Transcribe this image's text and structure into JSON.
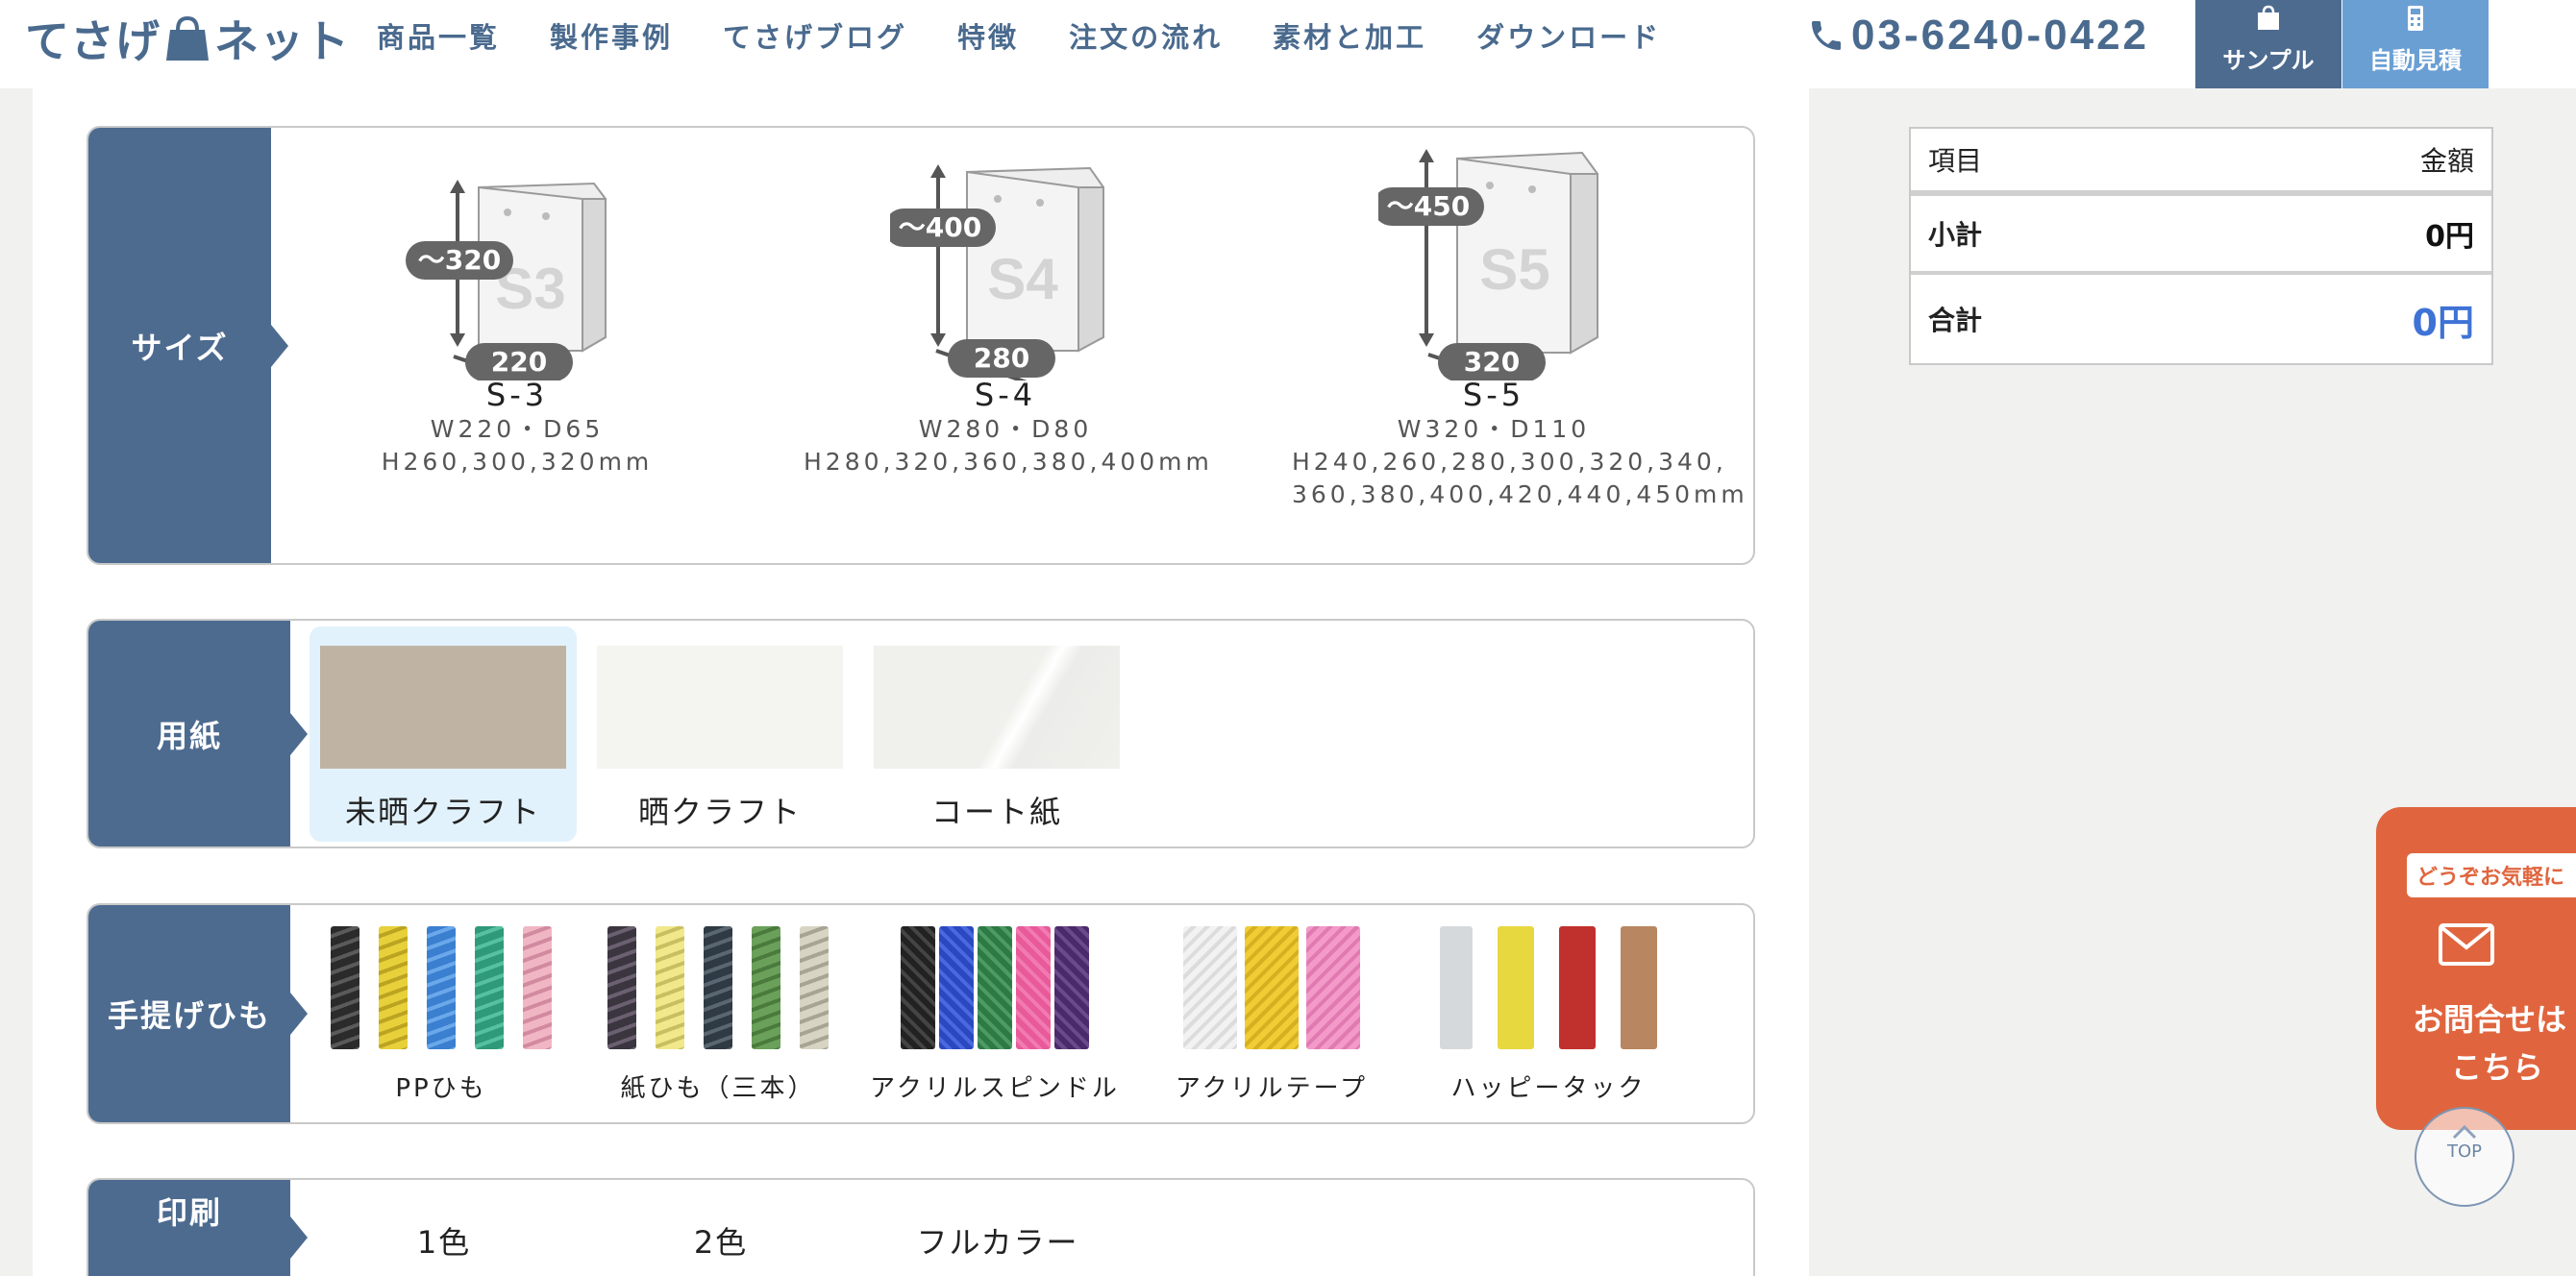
{
  "header": {
    "logo_text_left": "てさげ",
    "logo_text_right": "ネット",
    "nav": [
      "商品一覧",
      "製作事例",
      "てさげブログ",
      "特徴",
      "注文の流れ",
      "素材と加工",
      "ダウンロード"
    ],
    "phone": "03-6240-0422",
    "sample_label": "サンプル",
    "quote_label": "自動見積"
  },
  "size": {
    "label": "サイズ",
    "options": [
      {
        "name": "S-3",
        "spec1": "W220・D65",
        "spec2": "H260,300,320mm",
        "spec3": "",
        "height_badge": "〜320",
        "width_badge": "220",
        "bag_mark": "S3"
      },
      {
        "name": "S-4",
        "spec1": "W280・D80",
        "spec2": "H280,320,360,380,400mm",
        "spec3": "",
        "height_badge": "〜400",
        "width_badge": "280",
        "bag_mark": "S4"
      },
      {
        "name": "S-5",
        "spec1": "W320・D110",
        "spec2": "H240,260,280,300,320,340,",
        "spec3": "360,380,400,420,440,450mm",
        "height_badge": "〜450",
        "width_badge": "320",
        "bag_mark": "S5"
      }
    ]
  },
  "paper": {
    "label": "用紙",
    "options": [
      {
        "name": "未晒クラフト",
        "color": "#bfb4a3",
        "selected": true
      },
      {
        "name": "晒クラフト",
        "color": "#f4f4f0",
        "selected": false
      },
      {
        "name": "コート紙",
        "color": "#f0f0ec",
        "selected": false
      }
    ]
  },
  "rope": {
    "label": "手提げひも",
    "options": [
      {
        "name": "PPひも",
        "colors": [
          "#2b2b2b",
          "#e7d03a",
          "#3b7fd0",
          "#2e9a7a",
          "#f0b6c4"
        ]
      },
      {
        "name": "紙ひも（三本）",
        "colors": [
          "#3b3540",
          "#f0e88a",
          "#2f3a44",
          "#6aa05a",
          "#d8d4c4"
        ]
      },
      {
        "name": "アクリルスピンドル",
        "colors": [
          "#222222",
          "#2a48c0",
          "#2e7a44",
          "#e85a9a",
          "#4a2a6a"
        ]
      },
      {
        "name": "アクリルテープ",
        "colors": [
          "#f2f2f2",
          "#f1cc34",
          "#f39ac8"
        ]
      },
      {
        "name": "ハッピータック",
        "colors": [
          "#d6d9dc",
          "#e8d840",
          "#c0302c",
          "#b88660"
        ]
      }
    ]
  },
  "print": {
    "label": "印刷",
    "options": [
      "1色",
      "2色",
      "フルカラー"
    ]
  },
  "summary": {
    "head_item": "項目",
    "head_amount": "金額",
    "subtotal_label": "小計",
    "subtotal_value": "0円",
    "total_label": "合計",
    "total_value": "0円"
  },
  "contact": {
    "tag": "どうぞお気軽に",
    "line1": "お問合せは",
    "line2": "こちら"
  },
  "top_button": "TOP",
  "colors": {
    "navy": "#4d6b8f",
    "light_blue": "#6a9fd4",
    "orange": "#e0653e",
    "total_blue": "#3f72d6"
  }
}
